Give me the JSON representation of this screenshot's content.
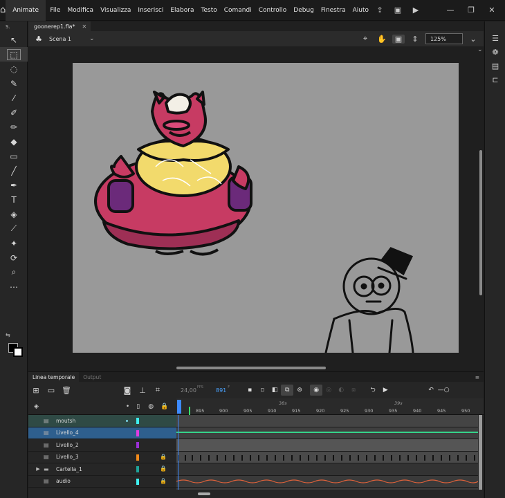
{
  "menubar": {
    "app_tab": "Animate",
    "items": [
      "File",
      "Modifica",
      "Visualizza",
      "Inserisci",
      "Elabora",
      "Testo",
      "Comandi",
      "Controllo",
      "Debug",
      "Finestra",
      "Aiuto"
    ]
  },
  "tools_header": "S.",
  "document": {
    "tab_title": "goonerep1.fla*",
    "close": "✕"
  },
  "scene": {
    "name": "Scena 1",
    "zoom": "125%"
  },
  "timeline": {
    "tabs": [
      "Linea temporale",
      "Output"
    ],
    "fps": "24,00",
    "fps_unit": "FPS",
    "current_frame": "891",
    "frame_unit": "F",
    "seconds": [
      "38s",
      "39s"
    ],
    "frame_ticks": [
      "895",
      "900",
      "905",
      "910",
      "915",
      "920",
      "925",
      "930",
      "935",
      "940",
      "945",
      "950"
    ],
    "layers": [
      {
        "name": "moutsh",
        "color": "#3ff0f0",
        "locked": false,
        "dot": true,
        "folder": false
      },
      {
        "name": "Livello_4",
        "color": "#e23ce2",
        "locked": false,
        "dot": false,
        "folder": false
      },
      {
        "name": "Livello_2",
        "color": "#9b2fd6",
        "locked": false,
        "dot": false,
        "folder": false
      },
      {
        "name": "Livello_3",
        "color": "#f28a1a",
        "locked": true,
        "dot": false,
        "folder": false
      },
      {
        "name": "Cartella_1",
        "color": "#1fa39a",
        "locked": true,
        "dot": false,
        "folder": true
      },
      {
        "name": "audio",
        "color": "#3ff0f0",
        "locked": true,
        "dot": false,
        "folder": false
      }
    ]
  },
  "colors": {
    "accent": "#3d8bff",
    "stage_bg": "#999999",
    "playhead": "#3d8bff"
  }
}
